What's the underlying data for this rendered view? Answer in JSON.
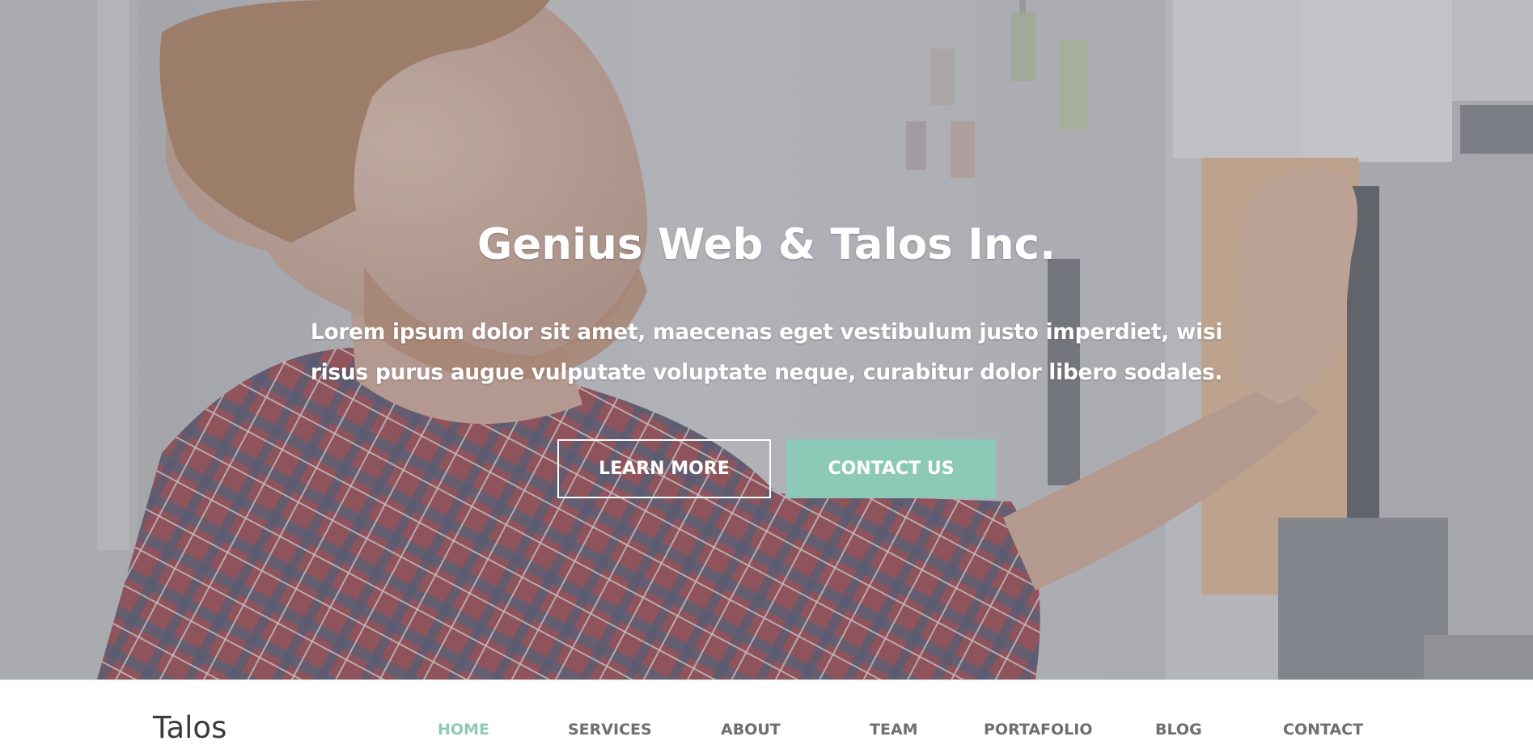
{
  "hero": {
    "title": "Genius Web & Talos Inc.",
    "subtitle": "Lorem ipsum dolor sit amet, maecenas eget vestibulum justo imperdiet, wisi risus purus augue vulputate voluptate neque, curabitur dolor libero sodales.",
    "learn_more_label": "LEARN MORE",
    "contact_us_label": "CONTACT US",
    "background_description_icon": "man-with-sticky-notes-photo"
  },
  "nav": {
    "brand": "Talos",
    "items": [
      {
        "label": "HOME",
        "active": true
      },
      {
        "label": "SERVICES",
        "active": false
      },
      {
        "label": "ABOUT",
        "active": false
      },
      {
        "label": "TEAM",
        "active": false
      },
      {
        "label": "PORTAFOLIO",
        "active": false
      },
      {
        "label": "BLOG",
        "active": false
      },
      {
        "label": "CONTACT",
        "active": false
      }
    ]
  },
  "colors": {
    "accent": "#8dc9b7",
    "nav_text": "#6f6f6f",
    "brand_text": "#3b3b3b"
  }
}
